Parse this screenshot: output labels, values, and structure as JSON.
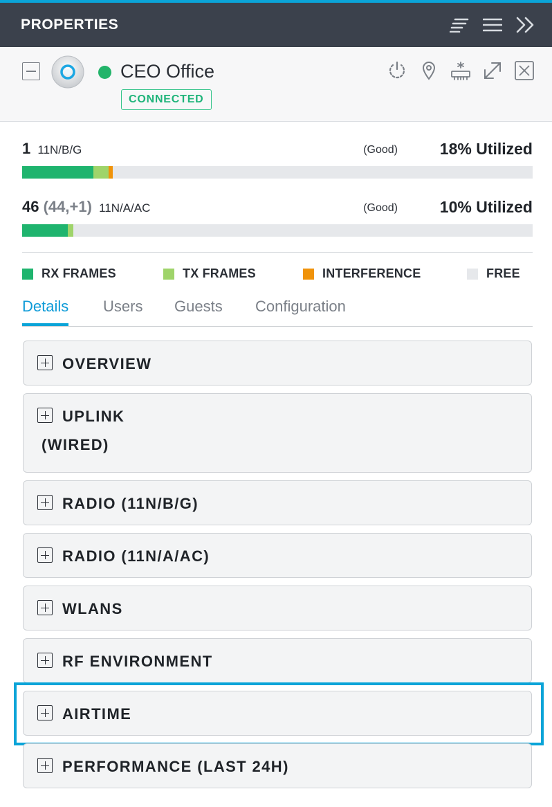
{
  "header": {
    "title": "PROPERTIES",
    "icons": [
      "list-sort-icon",
      "hamburger-menu-icon",
      "double-chevron-right-icon"
    ]
  },
  "device": {
    "name": "CEO Office",
    "status": "CONNECTED",
    "status_color": "#23b46a",
    "actions": [
      "power-icon",
      "location-pin-icon",
      "radio-scan-icon",
      "expand-icon",
      "close-icon"
    ]
  },
  "radios": [
    {
      "channel": "1",
      "channel_detail": "",
      "standard": "11N/B/G",
      "quality": "(Good)",
      "utilization": "18% Utilized",
      "rx_pct": 14,
      "tx_pct": 3,
      "interference_pct": 0.8
    },
    {
      "channel": "46",
      "channel_detail": "(44,+1)",
      "standard": "11N/A/AC",
      "quality": "(Good)",
      "utilization": "10% Utilized",
      "rx_pct": 9,
      "tx_pct": 1,
      "interference_pct": 0
    }
  ],
  "legend": [
    {
      "label": "RX FRAMES",
      "color": "#1fb46e"
    },
    {
      "label": "TX FRAMES",
      "color": "#9fd46a"
    },
    {
      "label": "INTERFERENCE",
      "color": "#f0930a"
    },
    {
      "label": "FREE",
      "color": "#e6e8eb"
    }
  ],
  "tabs": [
    "Details",
    "Users",
    "Guests",
    "Configuration"
  ],
  "active_tab": "Details",
  "sections": [
    {
      "label": "OVERVIEW"
    },
    {
      "label": "UPLINK",
      "label_line2": "(WIRED)"
    },
    {
      "label": "RADIO (11N/B/G)"
    },
    {
      "label": "RADIO (11N/A/AC)"
    },
    {
      "label": "WLANS"
    },
    {
      "label": "RF ENVIRONMENT"
    },
    {
      "label": "AIRTIME"
    },
    {
      "label": "PERFORMANCE (LAST 24H)"
    }
  ],
  "highlighted_section": "AIRTIME",
  "accent_color": "#0aa4d8"
}
